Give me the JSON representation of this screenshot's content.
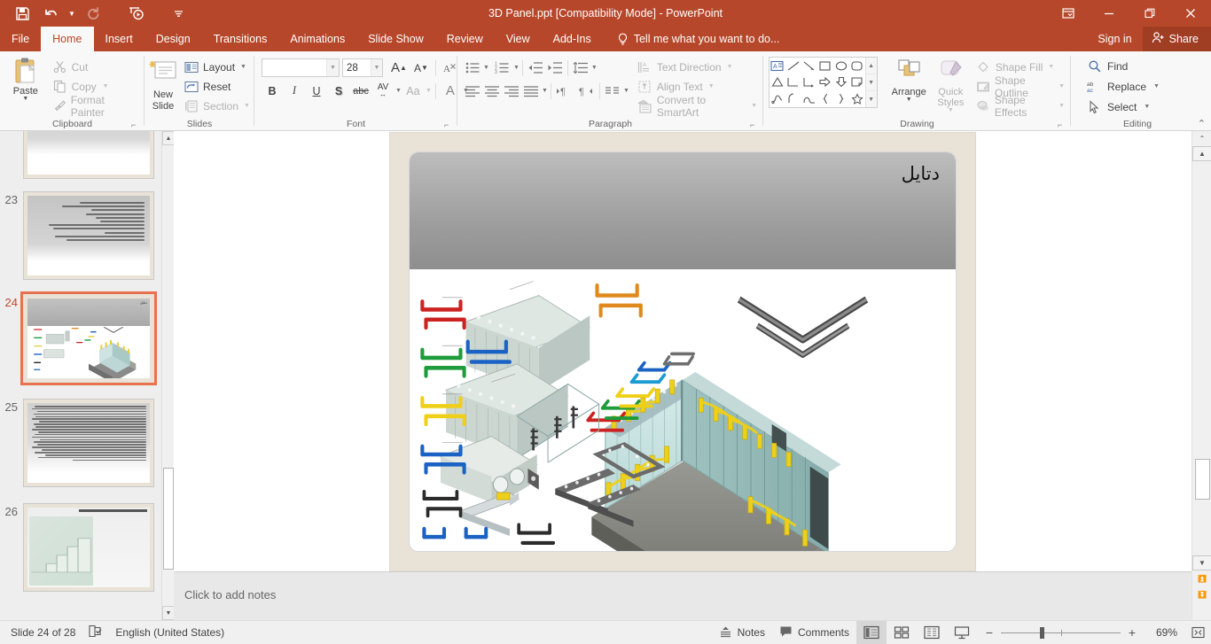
{
  "window": {
    "title": "3D Panel.ppt [Compatibility Mode] - PowerPoint",
    "accent_color": "#b7472a",
    "qat": [
      {
        "name": "save",
        "icon": "save-icon"
      },
      {
        "name": "undo",
        "icon": "undo-icon"
      },
      {
        "name": "redo",
        "icon": "redo-icon"
      },
      {
        "name": "start-from-beginning",
        "icon": "slideshow-icon"
      },
      {
        "name": "customize-qat",
        "icon": "chevron-down-icon"
      }
    ],
    "controls": {
      "ribbon_display": "ribbon-display-options-icon",
      "minimize": "minimize-icon",
      "restore": "restore-icon",
      "close": "close-icon"
    }
  },
  "tabs": [
    {
      "label": "File",
      "active": false
    },
    {
      "label": "Home",
      "active": true
    },
    {
      "label": "Insert",
      "active": false
    },
    {
      "label": "Design",
      "active": false
    },
    {
      "label": "Transitions",
      "active": false
    },
    {
      "label": "Animations",
      "active": false
    },
    {
      "label": "Slide Show",
      "active": false
    },
    {
      "label": "Review",
      "active": false
    },
    {
      "label": "View",
      "active": false
    },
    {
      "label": "Add-Ins",
      "active": false
    }
  ],
  "tellme": {
    "placeholder": "Tell me what you want to do..."
  },
  "account": {
    "signin": "Sign in",
    "share": "Share"
  },
  "ribbon": {
    "clipboard": {
      "group_label": "Clipboard",
      "paste": "Paste",
      "items": [
        {
          "label": "Cut",
          "icon": "scissors-icon"
        },
        {
          "label": "Copy",
          "icon": "copy-icon"
        },
        {
          "label": "Format Painter",
          "icon": "paintbrush-icon"
        }
      ]
    },
    "slides": {
      "group_label": "Slides",
      "new_slide": "New Slide",
      "items": [
        {
          "label": "Layout",
          "icon": "layout-icon"
        },
        {
          "label": "Reset",
          "icon": "reset-icon"
        },
        {
          "label": "Section",
          "icon": "section-icon"
        }
      ]
    },
    "font": {
      "group_label": "Font",
      "font_name": "",
      "font_name_placeholder": "",
      "font_size": "28",
      "buttons": [
        {
          "label": "B",
          "name": "bold"
        },
        {
          "label": "I",
          "name": "italic"
        },
        {
          "label": "U",
          "name": "underline"
        },
        {
          "label": "S",
          "name": "text-shadow"
        },
        {
          "label": "abc",
          "name": "strikethrough"
        },
        {
          "label": "AV",
          "name": "character-spacing"
        },
        {
          "label": "Aa",
          "name": "change-case"
        },
        {
          "label": "A",
          "name": "font-color"
        }
      ],
      "grow": "A",
      "shrink": "A",
      "clear_formatting": "clear-formatting-icon"
    },
    "paragraph": {
      "group_label": "Paragraph",
      "right_items": [
        {
          "label": "Text Direction",
          "icon": "text-direction-icon"
        },
        {
          "label": "Align Text",
          "icon": "align-text-icon"
        },
        {
          "label": "Convert to SmartArt",
          "icon": "smartart-icon"
        }
      ]
    },
    "drawing": {
      "group_label": "Drawing",
      "arrange": "Arrange",
      "quick_styles": "Quick Styles",
      "items": [
        {
          "label": "Shape Fill",
          "icon": "shape-fill-icon"
        },
        {
          "label": "Shape Outline",
          "icon": "shape-outline-icon"
        },
        {
          "label": "Shape Effects",
          "icon": "shape-effects-icon"
        }
      ]
    },
    "editing": {
      "group_label": "Editing",
      "items": [
        {
          "label": "Find",
          "icon": "search-icon"
        },
        {
          "label": "Replace",
          "icon": "replace-icon"
        },
        {
          "label": "Select",
          "icon": "cursor-icon"
        }
      ]
    }
  },
  "thumbnails": [
    {
      "number": "",
      "type": "text",
      "lines": 7,
      "active": false,
      "partial": true
    },
    {
      "number": "23",
      "type": "text",
      "lines": 11,
      "active": false,
      "partial": false
    },
    {
      "number": "24",
      "type": "diagram",
      "lines": 0,
      "active": true,
      "partial": false
    },
    {
      "number": "25",
      "type": "dense-text",
      "lines": 22,
      "active": false,
      "partial": false
    },
    {
      "number": "26",
      "type": "photo",
      "lines": 1,
      "active": false,
      "partial": true
    }
  ],
  "slide": {
    "title": "دتایل",
    "title_translit": "Detail",
    "art_name": "3d-panel-wall-assembly-diagram"
  },
  "notes": {
    "placeholder": "Click to add notes"
  },
  "status": {
    "slide_indicator": "Slide 24 of 28",
    "language": "English (United States)",
    "spellcheck_icon": "spellcheck-icon",
    "notes_label": "Notes",
    "comments_label": "Comments",
    "views": [
      {
        "name": "normal-view",
        "active": true
      },
      {
        "name": "slide-sorter-view",
        "active": false
      },
      {
        "name": "reading-view",
        "active": false
      },
      {
        "name": "slide-show-view",
        "active": false
      }
    ],
    "zoom_out": "−",
    "zoom_in": "+",
    "zoom_level": "69%",
    "fit_to_window": "fit-slide-icon"
  }
}
